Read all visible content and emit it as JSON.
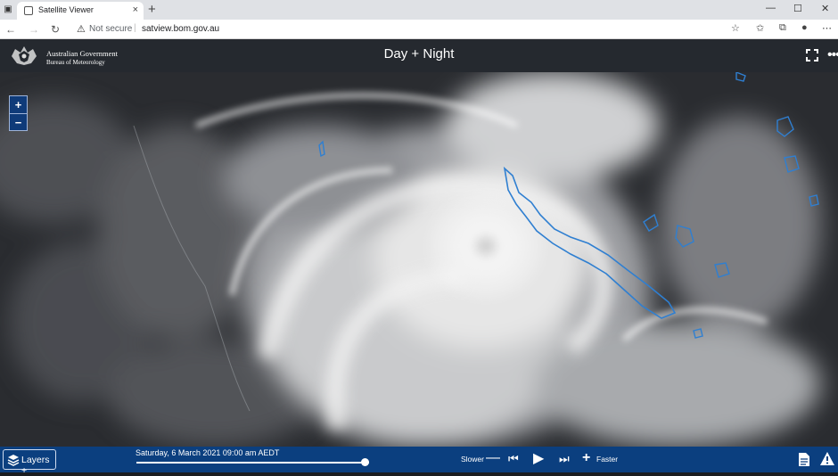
{
  "browser": {
    "tab_title": "Satellite Viewer",
    "tab_close": "×",
    "new_tab": "+",
    "security_label": "Not secure",
    "url": "satview.bom.gov.au",
    "window_controls": {
      "minimize": "—",
      "maximize": "☐",
      "close": "✕"
    }
  },
  "header": {
    "org_line1": "Australian Government",
    "org_line2": "Bureau of Meteorology",
    "view_title": "Day + Night"
  },
  "map": {
    "zoom_in": "+",
    "zoom_out": "−",
    "coastline_color": "#2f7fd1"
  },
  "controls": {
    "layers_label": "Layers +",
    "timestamp": "Saturday, 6 March 2021 09:00 am AEDT",
    "timeline_progress": 0.98,
    "slower_label": "Slower",
    "faster_label": "Faster"
  },
  "colors": {
    "header_bg": "#25292f",
    "bottom_bar_bg": "#0b3f7f",
    "zoom_bg": "#0f3b79"
  }
}
